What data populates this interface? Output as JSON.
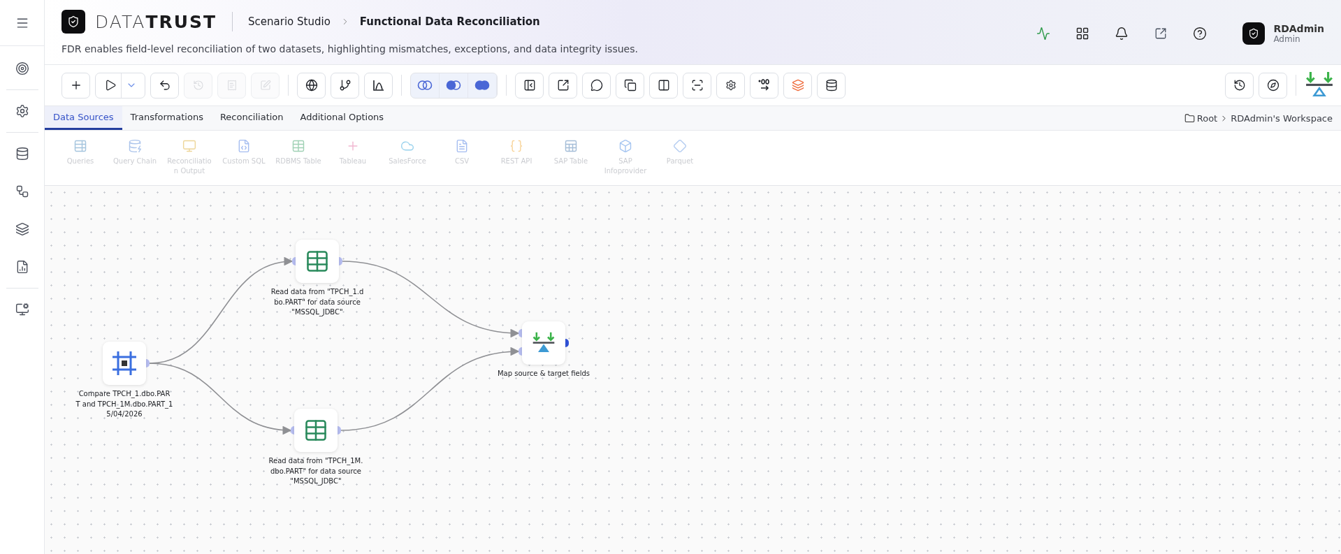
{
  "header": {
    "logo": "DATA**TRUST**",
    "breadcrumb": [
      "Scenario Studio",
      "Functional Data Reconciliation"
    ],
    "description": "FDR enables field-level reconciliation of two datasets, highlighting mismatches, exceptions, and data integrity issues.",
    "user": {
      "name": "RDAdmin",
      "role": "Admin"
    }
  },
  "toolbar": {
    "items": [
      {
        "kind": "button",
        "disabled": false
      },
      {
        "kind": "split",
        "disabled": false
      },
      {
        "kind": "button",
        "disabled": false
      },
      {
        "kind": "button",
        "disabled": true
      },
      {
        "kind": "button",
        "disabled": true
      },
      {
        "kind": "button",
        "disabled": true
      },
      {
        "kind": "separator"
      },
      {
        "kind": "button",
        "disabled": false
      },
      {
        "kind": "button",
        "disabled": false
      },
      {
        "kind": "button",
        "disabled": false
      },
      {
        "kind": "separator"
      },
      {
        "kind": "segment",
        "disabled": false
      },
      {
        "kind": "segment",
        "disabled": false
      },
      {
        "kind": "segment",
        "disabled": false
      },
      {
        "kind": "separator"
      },
      {
        "kind": "button",
        "disabled": false
      },
      {
        "kind": "button",
        "disabled": false
      },
      {
        "kind": "button",
        "disabled": false
      },
      {
        "kind": "button",
        "disabled": false
      },
      {
        "kind": "button",
        "disabled": false
      },
      {
        "kind": "button",
        "disabled": false
      },
      {
        "kind": "button",
        "disabled": false
      },
      {
        "kind": "button",
        "disabled": false
      },
      {
        "kind": "button",
        "disabled": false
      },
      {
        "kind": "button",
        "disabled": false
      }
    ]
  },
  "tabs": [
    {
      "label": "Data Sources",
      "selected": true
    },
    {
      "label": "Transformations",
      "selected": false
    },
    {
      "label": "Reconciliation",
      "selected": false
    },
    {
      "label": "Additional Options",
      "selected": false
    }
  ],
  "location": {
    "folder": "Root",
    "workspace": "RDAdmin's Workspace"
  },
  "palette": [
    {
      "label": "Queries",
      "disabled": true
    },
    {
      "label": "Query Chain",
      "disabled": true
    },
    {
      "label": "Reconciliatio\nn Output",
      "disabled": true
    },
    {
      "label": "Custom SQL",
      "disabled": true
    },
    {
      "label": "RDBMS Table",
      "disabled": true
    },
    {
      "label": "Tableau",
      "disabled": true
    },
    {
      "label": "SalesForce",
      "disabled": true
    },
    {
      "label": "CSV",
      "disabled": true
    },
    {
      "label": "REST API",
      "disabled": true
    },
    {
      "label": "SAP Table",
      "disabled": true
    },
    {
      "label": "SAP\nInfoprovider",
      "disabled": true
    },
    {
      "label": "Parquet",
      "disabled": true
    }
  ],
  "canvas": {
    "nodes": [
      {
        "kind": "compare",
        "label": "Compare TPCH_1.dbo.PAR\nT and TPCH_1M.dbo.PART_1\n5/04/2026"
      },
      {
        "kind": "source",
        "label": "Read data from \"TPCH_1.d\nbo.PART\" for data source\n\"MSSQL_JDBC\""
      },
      {
        "kind": "source",
        "label": "Read data from \"TPCH_1M.\ndbo.PART\" for data source\n\"MSSQL_JDBC\""
      },
      {
        "kind": "map",
        "label": "Map source & target fields"
      }
    ]
  }
}
